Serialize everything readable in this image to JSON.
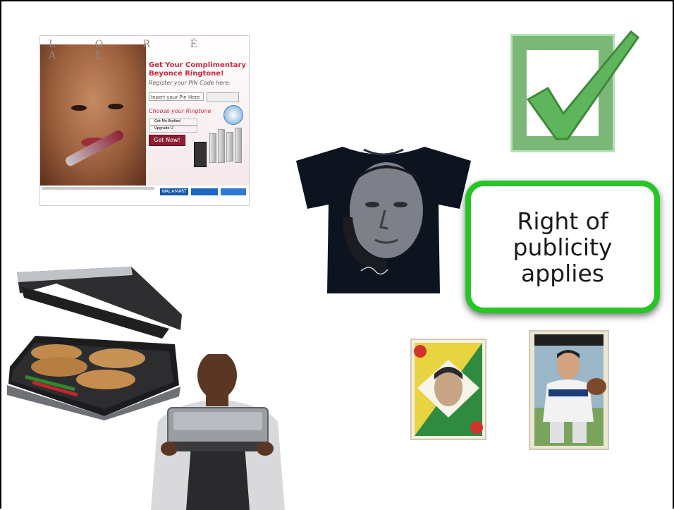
{
  "slide": {
    "callout_text": "Right of publicity applies"
  },
  "ad": {
    "brand_letters": "L O R É A L",
    "headline": "Get Your Complimentary Beyoncé Ringtone!",
    "subhead": "Register your PIN Code here:",
    "pin_placeholder": "Insert your Pin Here",
    "choose_label": "Choose your Ringtone",
    "option_1": "Get Me Bodied",
    "option_2": "Upgrade U",
    "button_label": "Get Now!",
    "retailer": "WAL★MART"
  },
  "colors": {
    "callout_border": "#27c526",
    "checkbox_fill": "#7bb878",
    "check_green": "#5fb55c"
  },
  "icons": {
    "checkbox": "checked-checkbox-icon"
  }
}
